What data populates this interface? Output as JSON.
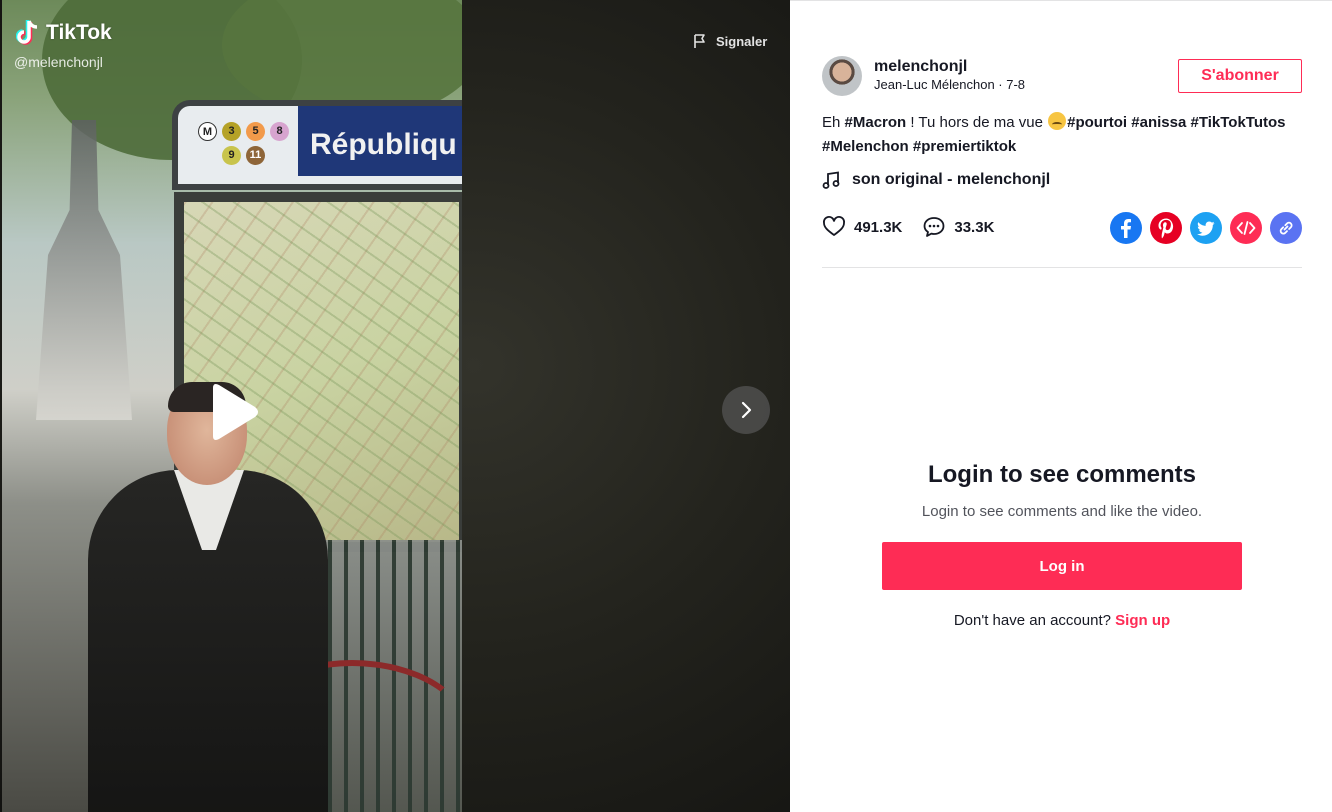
{
  "brand": {
    "name": "TikTok",
    "handle": "@melenchonjl"
  },
  "video": {
    "report_label": "Signaler",
    "sign_text": "Républiqu",
    "metro_lines": [
      "M",
      "3",
      "5",
      "8",
      "9",
      "11"
    ],
    "icons": {
      "play": "play-icon",
      "next": "chevron-right-icon",
      "report": "flag-icon"
    }
  },
  "author": {
    "username": "melenchonjl",
    "nickname_line": "Jean-Luc Mélenchon · 7-8",
    "follow_label": "S'abonner"
  },
  "caption": {
    "prefix": "Eh ",
    "tag_macron": "#Macron",
    "middle": " ! Tu hors de ma vue ",
    "tags": [
      "#pourtoi",
      "#anissa",
      "#TikTokTutos",
      "#Melenchon",
      "#premiertiktok"
    ]
  },
  "music": {
    "label": "son original - melenchonjl"
  },
  "stats": {
    "likes": "491.3K",
    "comments": "33.3K"
  },
  "share": [
    "facebook-icon",
    "pinterest-icon",
    "twitter-icon",
    "embed-icon",
    "link-icon"
  ],
  "login": {
    "title": "Login to see comments",
    "subtitle": "Login to see comments and like the video.",
    "button": "Log in",
    "no_account": "Don't have an account?",
    "signup": "Sign up"
  },
  "colors": {
    "accent": "#fe2c55",
    "facebook": "#1877f2",
    "pinterest": "#e60023",
    "twitter": "#1da1f2",
    "embed": "#fe2c55",
    "link": "#5a73f2"
  }
}
